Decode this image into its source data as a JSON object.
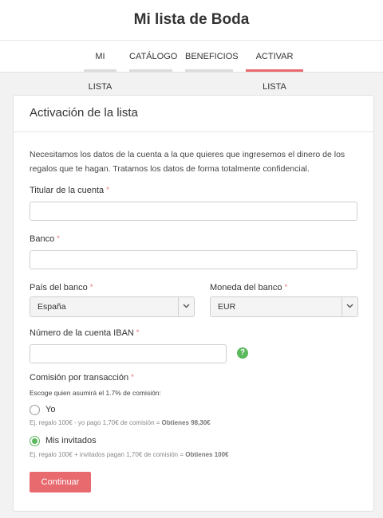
{
  "header": {
    "title": "Mi lista de Boda",
    "tabs": [
      {
        "label": "MI LISTA",
        "active": false
      },
      {
        "label": "CATÁLOGO",
        "active": false
      },
      {
        "label": "BENEFICIOS",
        "active": false
      },
      {
        "label": "ACTIVAR LISTA",
        "active": true
      }
    ]
  },
  "colors": {
    "accent": "#e86a6f",
    "success": "#5cb85c",
    "background": "#f2f2f2"
  },
  "form": {
    "title": "Activación de la lista",
    "intro": "Necesitamos los datos de la cuenta a la que quieres que ingresemos el dinero de los regalos que te hagan. Tratamos los datos de forma totalmente confidencial.",
    "required_mark": "*",
    "account_holder": {
      "label": "Titular de la cuenta",
      "value": ""
    },
    "bank": {
      "label": "Banco",
      "value": ""
    },
    "bank_country": {
      "label": "País del banco",
      "value": "España"
    },
    "bank_currency": {
      "label": "Moneda del banco",
      "value": "EUR"
    },
    "iban": {
      "label": "Número de la cuenta IBAN",
      "value": "",
      "help_icon": "question-circle-icon",
      "help_symbol": "?"
    },
    "commission": {
      "label": "Comisión por transacción",
      "subtitle": "Escoge quien asumirá el 1.7% de comisión:",
      "options": [
        {
          "label": "Yo",
          "selected": false,
          "example": "Ej. regalo 100€ - yo pago 1,70€ de comisión = ",
          "example_result": "Obtienes 98,30€"
        },
        {
          "label": "Mis invitados",
          "selected": true,
          "example": "Ej. regalo 100€ + invitados pagan 1,70€ de comisión = ",
          "example_result": "Obtienes 100€"
        }
      ]
    },
    "submit_label": "Continuar"
  }
}
